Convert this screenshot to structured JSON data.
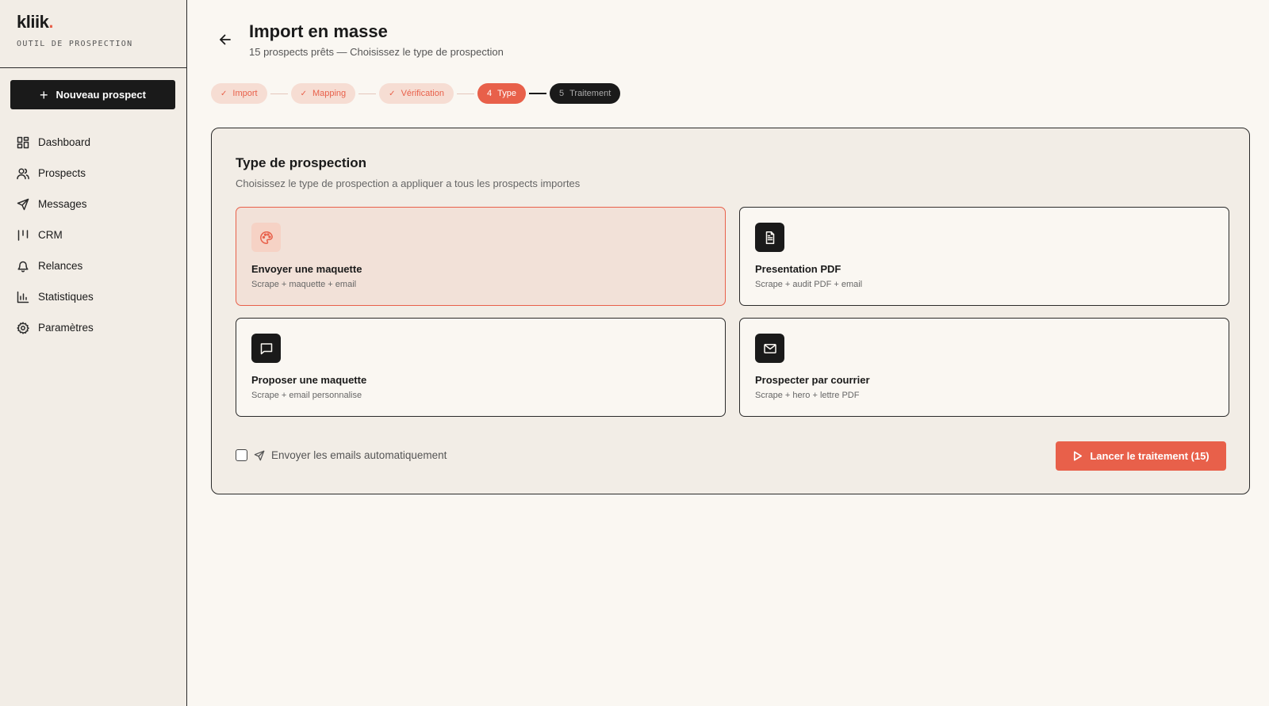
{
  "brand": {
    "logo_text": "kliik",
    "logo_dot": ".",
    "tagline": "OUTIL DE PROSPECTION"
  },
  "sidebar": {
    "new_button": "Nouveau prospect",
    "items": [
      {
        "label": "Dashboard",
        "icon": "dashboard-icon"
      },
      {
        "label": "Prospects",
        "icon": "users-icon"
      },
      {
        "label": "Messages",
        "icon": "send-icon"
      },
      {
        "label": "CRM",
        "icon": "kanban-icon"
      },
      {
        "label": "Relances",
        "icon": "bell-icon"
      },
      {
        "label": "Statistiques",
        "icon": "bar-chart-icon"
      },
      {
        "label": "Paramètres",
        "icon": "gear-icon"
      }
    ]
  },
  "header": {
    "title": "Import en masse",
    "subtitle": "15 prospects prêts — Choisissez le type de prospection"
  },
  "steps": [
    {
      "label": "Import",
      "state": "done"
    },
    {
      "label": "Mapping",
      "state": "done"
    },
    {
      "label": "Vérification",
      "state": "done"
    },
    {
      "number": "4",
      "label": "Type",
      "state": "active"
    },
    {
      "number": "5",
      "label": "Traitement",
      "state": "todo"
    }
  ],
  "panel": {
    "title": "Type de prospection",
    "description": "Choisissez le type de prospection a appliquer a tous les prospects importes",
    "options": [
      {
        "title": "Envoyer une maquette",
        "description": "Scrape + maquette + email",
        "icon": "palette-icon",
        "selected": true
      },
      {
        "title": "Presentation PDF",
        "description": "Scrape + audit PDF + email",
        "icon": "document-icon",
        "selected": false
      },
      {
        "title": "Proposer une maquette",
        "description": "Scrape + email personnalise",
        "icon": "message-icon",
        "selected": false
      },
      {
        "title": "Prospecter par courrier",
        "description": "Scrape + hero + lettre PDF",
        "icon": "mail-icon",
        "selected": false
      }
    ],
    "auto_send_label": "Envoyer les emails automatiquement",
    "auto_send_checked": false,
    "launch_label": "Lancer le traitement (15)"
  },
  "colors": {
    "accent": "#e8604a",
    "dark": "#1a1a1a",
    "background": "#faf7f2",
    "sidebar": "#f2ede6"
  }
}
